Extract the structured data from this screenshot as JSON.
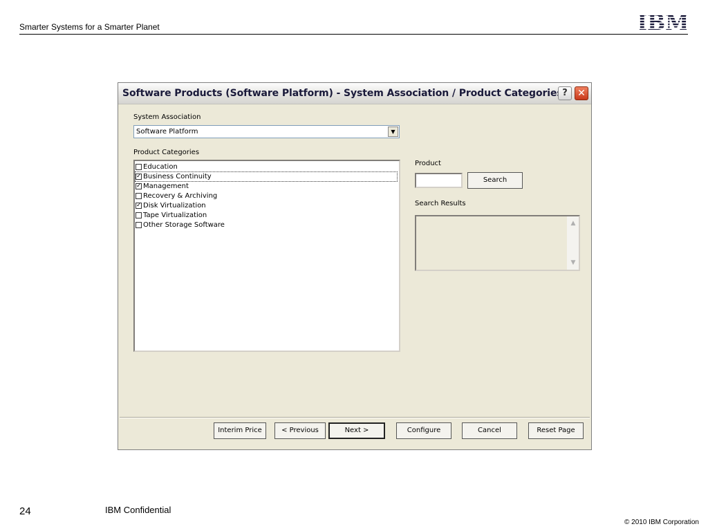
{
  "slide": {
    "header_text": "Smarter Systems for a Smarter Planet",
    "logo_text": "IBM",
    "page_number": "24",
    "confidential": "IBM Confidential",
    "copyright": "© 2010 IBM Corporation"
  },
  "dialog": {
    "title": "Software Products (Software Platform) - System Association / Product Categories",
    "help_label": "?",
    "close_label": "✕",
    "system_association": {
      "label": "System Association",
      "selected": "Software Platform"
    },
    "product_categories": {
      "label": "Product Categories",
      "items": [
        {
          "label": "Education",
          "checked": false
        },
        {
          "label": "Business Continuity",
          "checked": true
        },
        {
          "label": "Management",
          "checked": true
        },
        {
          "label": "Recovery & Archiving",
          "checked": false
        },
        {
          "label": "Disk Virtualization",
          "checked": true
        },
        {
          "label": "Tape Virtualization",
          "checked": false
        },
        {
          "label": "Other Storage Software",
          "checked": false
        }
      ]
    },
    "product": {
      "label": "Product",
      "value": ""
    },
    "search_button": "Search",
    "search_results_label": "Search Results",
    "buttons": {
      "interim_price": "Interim Price",
      "previous": "< Previous",
      "next": "Next >",
      "configure": "Configure",
      "cancel": "Cancel",
      "reset_page": "Reset Page"
    },
    "icons": {
      "dropdown": "chevron-down-icon",
      "scroll_up": "scroll-up-icon",
      "scroll_down": "scroll-down-icon"
    }
  }
}
